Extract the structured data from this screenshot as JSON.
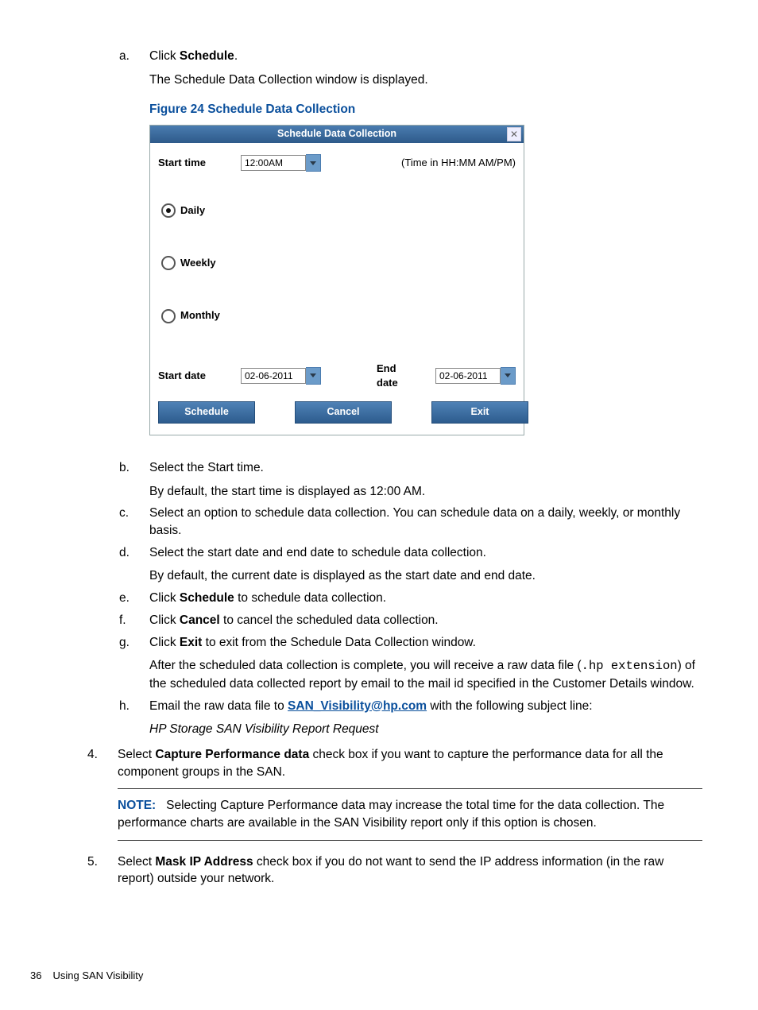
{
  "steps": {
    "a": {
      "marker": "a.",
      "lead": "Click ",
      "bold": "Schedule",
      "tail": ".",
      "line2": "The Schedule Data Collection window is displayed."
    },
    "b": {
      "marker": "b.",
      "line1": "Select the Start time.",
      "line2": "By default, the start time is displayed as 12:00 AM."
    },
    "c": {
      "marker": "c.",
      "text": "Select an option to schedule data collection. You can schedule data on a daily, weekly, or monthly basis."
    },
    "d": {
      "marker": "d.",
      "line1": "Select the start date and end date to schedule data collection.",
      "line2": "By default, the current date is displayed as the start date and end date."
    },
    "e": {
      "marker": "e.",
      "lead": "Click ",
      "bold": "Schedule",
      "tail": " to schedule data collection."
    },
    "f": {
      "marker": "f.",
      "lead": "Click ",
      "bold": "Cancel",
      "tail": " to cancel the scheduled data collection."
    },
    "g": {
      "marker": "g.",
      "lead": "Click ",
      "bold": "Exit",
      "tail": " to exit from the Schedule Data Collection window.",
      "line2_a": "After the scheduled data collection is complete, you will receive a raw data file (",
      "line2_mono": ".hp extension",
      "line2_b": ") of the scheduled data collected report by email to the mail id specified in the Customer Details window."
    },
    "h": {
      "marker": "h.",
      "lead": "Email the raw data file to ",
      "link": "SAN_Visibility@hp.com",
      "tail": " with the following subject line:",
      "italic": "HP Storage SAN Visibility Report Request"
    }
  },
  "figure": {
    "caption": "Figure 24 Schedule Data Collection"
  },
  "dialog": {
    "title": "Schedule Data Collection",
    "start_time_label": "Start time",
    "start_time_value": "12:00AM",
    "time_hint": "(Time in HH:MM AM/PM)",
    "daily": "Daily",
    "weekly": "Weekly",
    "monthly": "Monthly",
    "start_date_label": "Start date",
    "start_date_value": "02-06-2011",
    "end_date_label": "End date",
    "end_date_value": "02-06-2011",
    "schedule_btn": "Schedule",
    "cancel_btn": "Cancel",
    "exit_btn": "Exit",
    "close_x": "✕"
  },
  "top4": {
    "marker": "4.",
    "lead": "Select ",
    "bold": "Capture Performance data",
    "tail": " check box if you want to capture the performance data for all the component groups in the SAN.",
    "note_label": "NOTE:",
    "note_text": "Selecting Capture Performance data may increase the total time for the data collection. The performance charts are available in the SAN Visibility report only if this option is chosen."
  },
  "top5": {
    "marker": "5.",
    "lead": "Select ",
    "bold": "Mask IP Address",
    "tail": " check box if you do not want to send the IP address information (in the raw report) outside your network."
  },
  "footer": {
    "page": "36",
    "title": "Using SAN Visibility"
  }
}
